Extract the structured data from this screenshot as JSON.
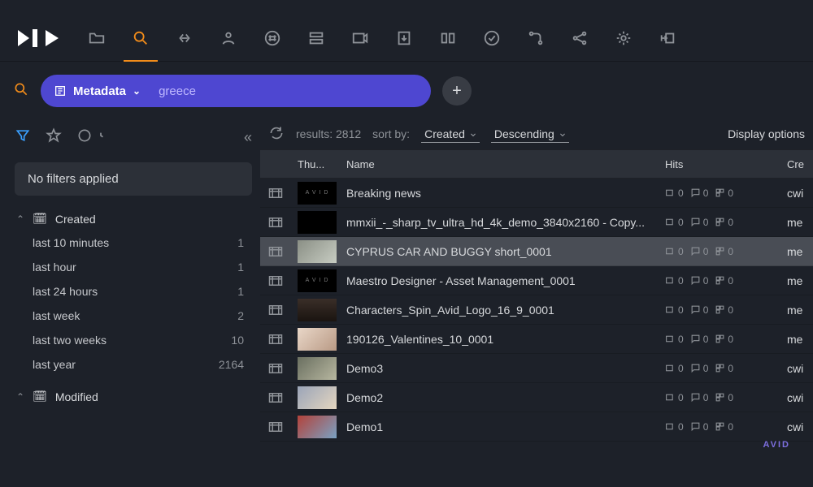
{
  "toolbar_icons": [
    "folder",
    "search",
    "link",
    "person",
    "hash",
    "storage",
    "video",
    "download",
    "panel",
    "check",
    "route",
    "share",
    "globe",
    "output"
  ],
  "active_toolbar": "search",
  "search": {
    "field_label": "Metadata",
    "term": "greece"
  },
  "sidebar": {
    "no_filters_label": "No filters applied",
    "collapse_glyph": "«",
    "facets": [
      {
        "name": "Created",
        "items": [
          {
            "label": "last 10 minutes",
            "count": 1
          },
          {
            "label": "last hour",
            "count": 1
          },
          {
            "label": "last 24 hours",
            "count": 1
          },
          {
            "label": "last week",
            "count": 2
          },
          {
            "label": "last two weeks",
            "count": 10
          },
          {
            "label": "last year",
            "count": 2164
          }
        ]
      },
      {
        "name": "Modified",
        "items": []
      }
    ]
  },
  "results": {
    "count_label": "results:",
    "count": 2812,
    "sort_by_label": "sort by:",
    "sort_field": "Created",
    "sort_dir": "Descending",
    "display_options_label": "Display options",
    "columns": {
      "thumb": "Thu...",
      "name": "Name",
      "hits": "Hits",
      "created": "Cre"
    },
    "rows": [
      {
        "thumb": "avid",
        "name": "Breaking news",
        "hits": [
          0,
          0,
          0
        ],
        "creator": "cwi"
      },
      {
        "thumb": "black",
        "name": "mmxii_-_sharp_tv_ultra_hd_4k_demo_3840x2160 - Copy...",
        "hits": [
          0,
          0,
          0
        ],
        "creator": "me"
      },
      {
        "thumb": "img1",
        "name": "CYPRUS CAR AND BUGGY short_0001",
        "hits": [
          0,
          0,
          0
        ],
        "creator": "me",
        "selected": true
      },
      {
        "thumb": "avid",
        "name": "Maestro Designer - Asset Management_0001",
        "hits": [
          0,
          0,
          0
        ],
        "creator": "me"
      },
      {
        "thumb": "img2",
        "name": "Characters_Spin_Avid_Logo_16_9_0001",
        "hits": [
          0,
          0,
          0
        ],
        "creator": "me"
      },
      {
        "thumb": "img3",
        "name": "190126_Valentines_10_0001",
        "hits": [
          0,
          0,
          0
        ],
        "creator": "me"
      },
      {
        "thumb": "img4",
        "name": "Demo3",
        "hits": [
          0,
          0,
          0
        ],
        "creator": "cwi"
      },
      {
        "thumb": "img5",
        "name": "Demo2",
        "hits": [
          0,
          0,
          0
        ],
        "creator": "cwi"
      },
      {
        "thumb": "img6",
        "name": "Demo1",
        "hits": [
          0,
          0,
          0
        ],
        "creator": "cwi"
      }
    ]
  },
  "corner_brand": "AVID"
}
